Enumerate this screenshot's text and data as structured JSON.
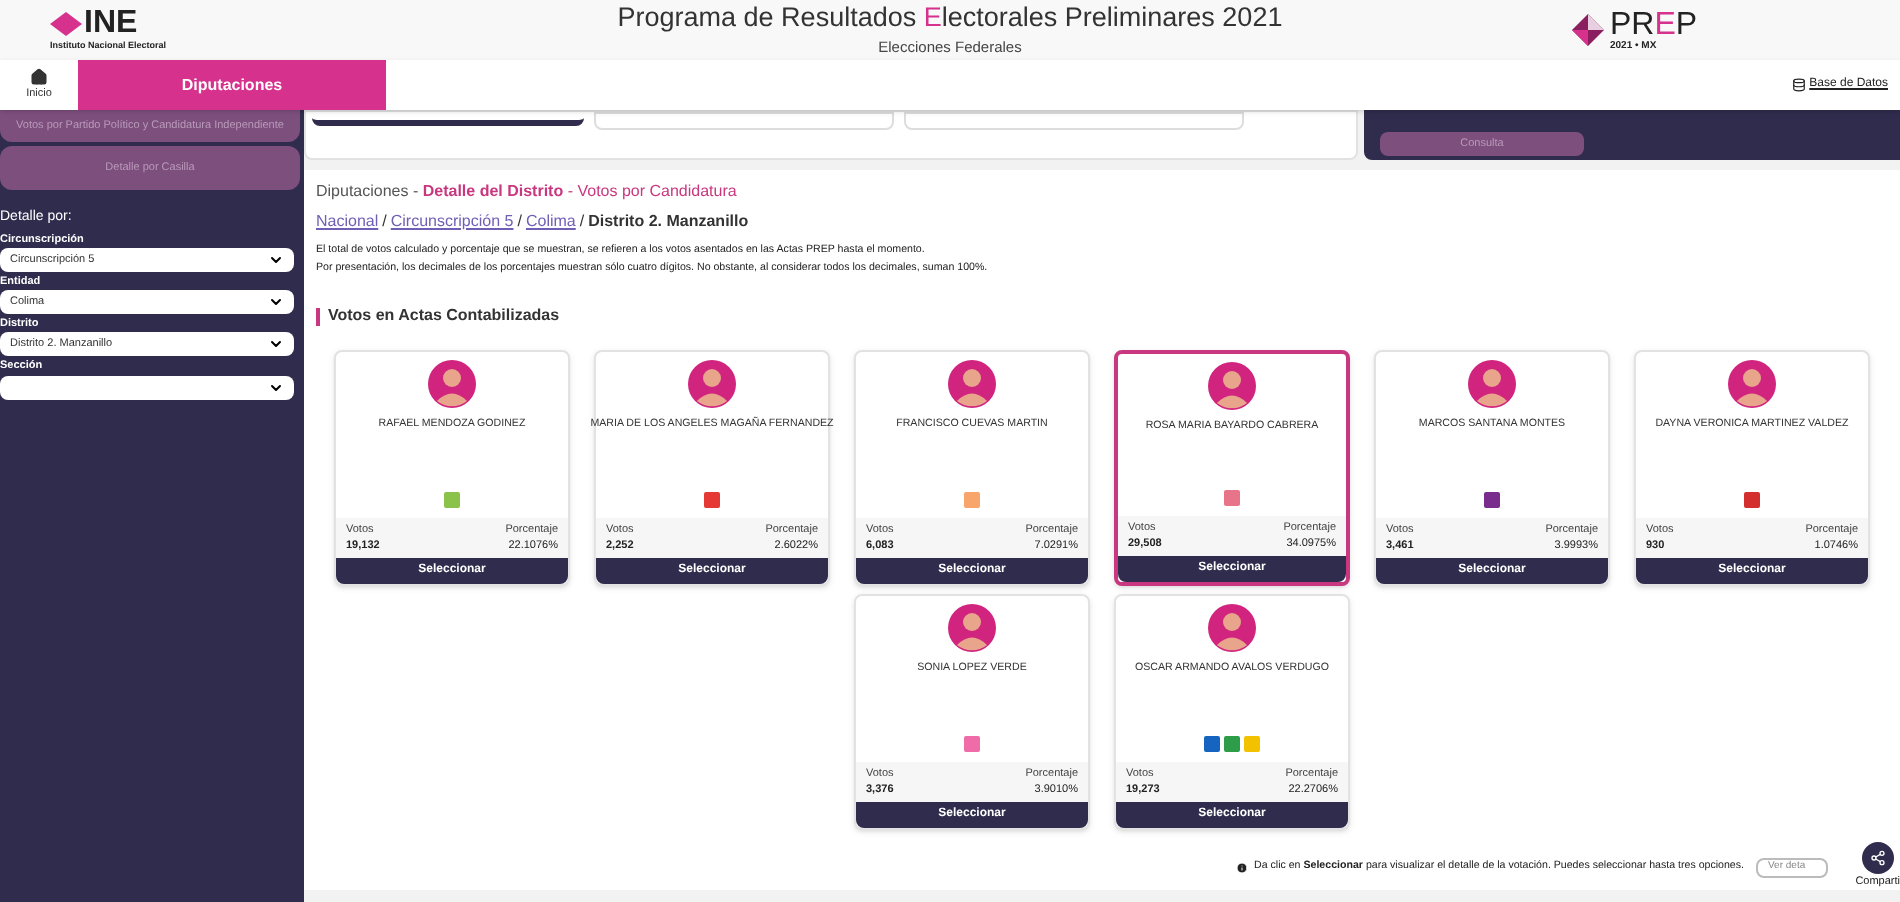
{
  "header": {
    "logo": {
      "name": "INE",
      "subtitle": "Instituto Nacional Electoral"
    },
    "title_parts": [
      {
        "text": "Programa de Resultados ",
        "accent": false
      },
      {
        "text": "E",
        "accent": true
      },
      {
        "text": "lectorales Preliminares 2021",
        "accent": false
      }
    ],
    "subtitle": "Elecciones Federales",
    "prep_logo": {
      "parts": [
        {
          "text": "PR",
          "accent": false
        },
        {
          "text": "E",
          "accent": true
        },
        {
          "text": "P",
          "accent": false
        }
      ],
      "caption": "2021 • MX"
    }
  },
  "nav": {
    "tabs": [
      {
        "label": "Inicio",
        "kind": "home",
        "selected": false
      },
      {
        "label": "Diputaciones",
        "kind": "text",
        "selected": true
      }
    ],
    "database_link": "Base de Datos"
  },
  "sidebar": {
    "buttons": [
      "Votos por Partido Político y Candidatura Independiente",
      "Detalle por Casilla"
    ],
    "heading": "Detalle por:",
    "filters": [
      {
        "label": "Circunscripción",
        "value": "Circunscripción 5"
      },
      {
        "label": "Entidad",
        "value": "Colima"
      },
      {
        "label": "Distrito",
        "value": "Distrito 2. Manzanillo"
      },
      {
        "label": "Sección"
      }
    ]
  },
  "query_panel": {
    "button": "Consulta"
  },
  "content": {
    "title_parts": [
      {
        "text": "Diputaciones - ",
        "kind": "plain"
      },
      {
        "text": "Detalle del Distrito",
        "kind": "strong"
      },
      {
        "text": " - Votos por Candidatura",
        "kind": "accent"
      }
    ],
    "breadcrumb": [
      {
        "label": "Nacional",
        "link": true,
        "separator": "/"
      },
      {
        "label": "Circunscripción 5",
        "link": true,
        "separator": "/"
      },
      {
        "label": "Colima",
        "link": true,
        "separator": "/"
      },
      {
        "label": "Distrito 2. Manzanillo",
        "link": false
      }
    ],
    "notes": [
      "El total de votos calculado y porcentaje que se muestran, se refieren a los votos asentados en las Actas PREP hasta el momento.",
      "Por presentación, los decimales de los porcentajes muestran sólo cuatro dígitos. No obstante, al considerar todos los decimales, suman 100%."
    ],
    "section_title": "Votos en Actas Contabilizadas",
    "candidates": [
      {
        "name": "RAFAEL MENDOZA GODINEZ",
        "votes_label": "Votos",
        "votes": "19,132",
        "percent_label": "Porcentaje",
        "percent": "22.1076%",
        "select_label": "Seleccionar",
        "selected": false,
        "parties": [
          {
            "color": "#8bc34a"
          }
        ]
      },
      {
        "name": "MARIA DE LOS ANGELES MAGAÑA FERNANDEZ",
        "votes_label": "Votos",
        "votes": "2,252",
        "percent_label": "Porcentaje",
        "percent": "2.6022%",
        "select_label": "Seleccionar",
        "selected": false,
        "parties": [
          {
            "color": "#e53935"
          }
        ]
      },
      {
        "name": "FRANCISCO CUEVAS MARTIN",
        "votes_label": "Votos",
        "votes": "6,083",
        "percent_label": "Porcentaje",
        "percent": "7.0291%",
        "select_label": "Seleccionar",
        "selected": false,
        "parties": [
          {
            "color": "#f7a56a"
          }
        ]
      },
      {
        "name": "ROSA MARIA BAYARDO CABRERA",
        "votes_label": "Votos",
        "votes": "29,508",
        "percent_label": "Porcentaje",
        "percent": "34.0975%",
        "select_label": "Seleccionar",
        "selected": true,
        "parties": [
          {
            "color": "#e8748a"
          }
        ]
      },
      {
        "name": "MARCOS SANTANA MONTES",
        "votes_label": "Votos",
        "votes": "3,461",
        "percent_label": "Porcentaje",
        "percent": "3.9993%",
        "select_label": "Seleccionar",
        "selected": false,
        "parties": [
          {
            "color": "#7b2d8e"
          }
        ]
      },
      {
        "name": "DAYNA VERONICA MARTINEZ VALDEZ",
        "votes_label": "Votos",
        "votes": "930",
        "percent_label": "Porcentaje",
        "percent": "1.0746%",
        "select_label": "Seleccionar",
        "selected": false,
        "parties": [
          {
            "color": "#d32f2f"
          }
        ]
      },
      {
        "name": "SONIA LOPEZ VERDE",
        "votes_label": "Votos",
        "votes": "3,376",
        "percent_label": "Porcentaje",
        "percent": "3.9010%",
        "select_label": "Seleccionar",
        "selected": false,
        "parties": [
          {
            "color": "#f06ca8"
          }
        ]
      },
      {
        "name": "OSCAR ARMANDO AVALOS VERDUGO",
        "votes_label": "Votos",
        "votes": "19,273",
        "percent_label": "Porcentaje",
        "percent": "22.2706%",
        "select_label": "Seleccionar",
        "selected": false,
        "parties": [
          {
            "color": "#1565c0"
          },
          {
            "color": "#2e9d4a"
          },
          {
            "color": "#f2c200"
          }
        ]
      }
    ],
    "footer_note": "Da clic en **Seleccionar** para visualizar el detalle de la votación. Puedes seleccionar hasta tres opciones.",
    "detail_button": "Ver deta"
  },
  "share": {
    "label": "Comparti"
  }
}
